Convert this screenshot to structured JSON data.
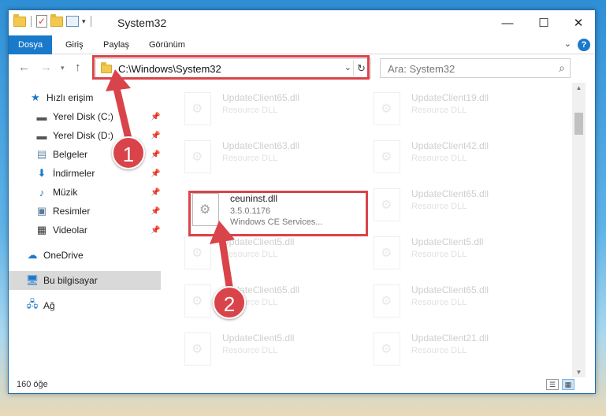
{
  "window": {
    "title": "System32"
  },
  "ribbon": {
    "tabs": [
      "Dosya",
      "Giriş",
      "Paylaş",
      "Görünüm"
    ],
    "help_label": "?"
  },
  "address": {
    "path": "C:\\Windows\\System32"
  },
  "search": {
    "placeholder": "Ara: System32"
  },
  "sidebar": {
    "items": [
      {
        "label": "Hızlı erişim",
        "icon": "star-icon"
      },
      {
        "label": "Yerel Disk (C:)",
        "icon": "drive-icon"
      },
      {
        "label": "Yerel Disk (D:)",
        "icon": "drive-icon"
      },
      {
        "label": "Belgeler",
        "icon": "documents-icon"
      },
      {
        "label": "İndirmeler",
        "icon": "download-icon"
      },
      {
        "label": "Müzik",
        "icon": "music-icon"
      },
      {
        "label": "Resimler",
        "icon": "pictures-icon"
      },
      {
        "label": "Videolar",
        "icon": "video-icon"
      },
      {
        "label": "OneDrive",
        "icon": "cloud-icon"
      },
      {
        "label": "Bu bilgisayar",
        "icon": "computer-icon"
      },
      {
        "label": "Ağ",
        "icon": "network-icon"
      }
    ]
  },
  "files": {
    "left": [
      {
        "name": "UpdateClient65.dll",
        "type": "Resource DLL"
      },
      {
        "name": "UpdateClient63.dll",
        "type": "Resource DLL"
      },
      {
        "name": "ceuninst.dll",
        "version": "3.5.0.1176",
        "desc": "Windows CE Services..."
      },
      {
        "name": "UpdateClient5.dll",
        "type": "Resource DLL"
      },
      {
        "name": "UpdateClient65.dll",
        "type": "Resource DLL"
      },
      {
        "name": "UpdateClient5.dll",
        "type": "Resource DLL"
      }
    ],
    "right": [
      {
        "name": "UpdateClient19.dll",
        "type": "Resource DLL"
      },
      {
        "name": "UpdateClient42.dll",
        "type": "Resource DLL"
      },
      {
        "name": "UpdateClient65.dll",
        "type": "Resource DLL"
      },
      {
        "name": "UpdateClient5.dll",
        "type": "Resource DLL"
      },
      {
        "name": "UpdateClient65.dll",
        "type": "Resource DLL"
      },
      {
        "name": "UpdateClient21.dll",
        "type": "Resource DLL"
      }
    ]
  },
  "status": {
    "count": "160 öğe"
  },
  "annotations": {
    "step1": "1",
    "step2": "2",
    "color": "#d9444a"
  }
}
